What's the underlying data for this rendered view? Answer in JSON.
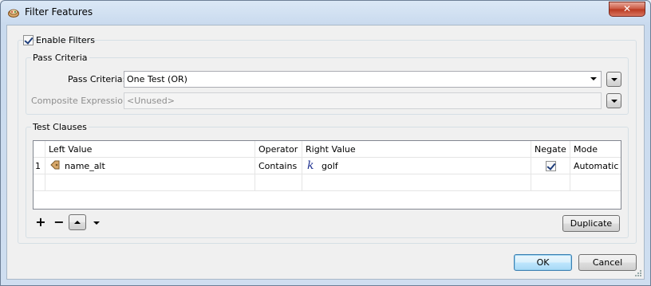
{
  "window": {
    "title": "Filter Features",
    "close_label": "✕"
  },
  "enable_filters": {
    "label": "Enable Filters",
    "checked": true
  },
  "pass_criteria_group": {
    "title": "Pass Criteria",
    "pass_criteria_label": "Pass Criteria:",
    "pass_criteria_value": "One Test (OR)",
    "composite_label": "Composite Expression:",
    "composite_value": "<Unused>"
  },
  "test_clauses_group": {
    "title": "Test Clauses",
    "columns": [
      "Left Value",
      "Operator",
      "Right Value",
      "Negate",
      "Mode"
    ],
    "rows": [
      {
        "num": "1",
        "left_value": "name_alt",
        "left_icon": "attribute-icon",
        "operator": "Contains",
        "right_icon": "string-k-icon",
        "right_value": "golf",
        "negate": true,
        "mode": "Automatic"
      }
    ],
    "add_label": "+",
    "remove_label": "−",
    "duplicate_label": "Duplicate"
  },
  "buttons": {
    "ok": "OK",
    "cancel": "Cancel"
  }
}
